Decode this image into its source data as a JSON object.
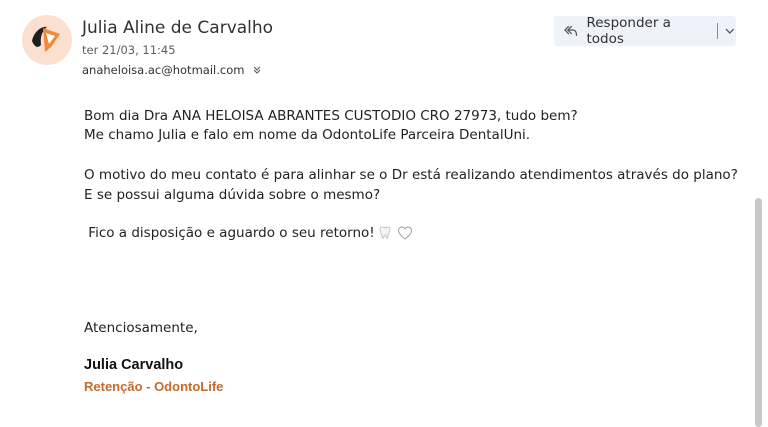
{
  "message": {
    "sender_name": "Julia Aline de Carvalho",
    "sent_date": "ter 21/03, 11:45",
    "recipient": "anaheloisa.ac@hotmail.com",
    "reply_all_label": "Responder a todos",
    "body": {
      "greeting": "Bom dia Dra  ANA HELOISA ABRANTES CUSTODIO CRO 27973, tudo bem?",
      "intro": "Me chamo Julia e falo em nome da OdontoLife Parceira DentalUni.",
      "motive": "O motivo do meu contato é para alinhar se o Dr está realizando atendimentos através do plano? E se possui alguma dúvida sobre o mesmo?",
      "closing": " Fico a disposição e aguardo o seu retorno!",
      "sign_off": "Atenciosamente,"
    },
    "signature": {
      "name": "Julia Carvalho",
      "role": "Retenção - OdontoLife"
    }
  },
  "colors": {
    "accent": "#c46a2d",
    "avatar_bg": "#fbe0cf",
    "reply_bg": "#edf3f8"
  },
  "icons": [
    "avatar-logo",
    "reply-all-icon",
    "chevron-down-icon",
    "tooth-icon",
    "white-heart-icon"
  ]
}
